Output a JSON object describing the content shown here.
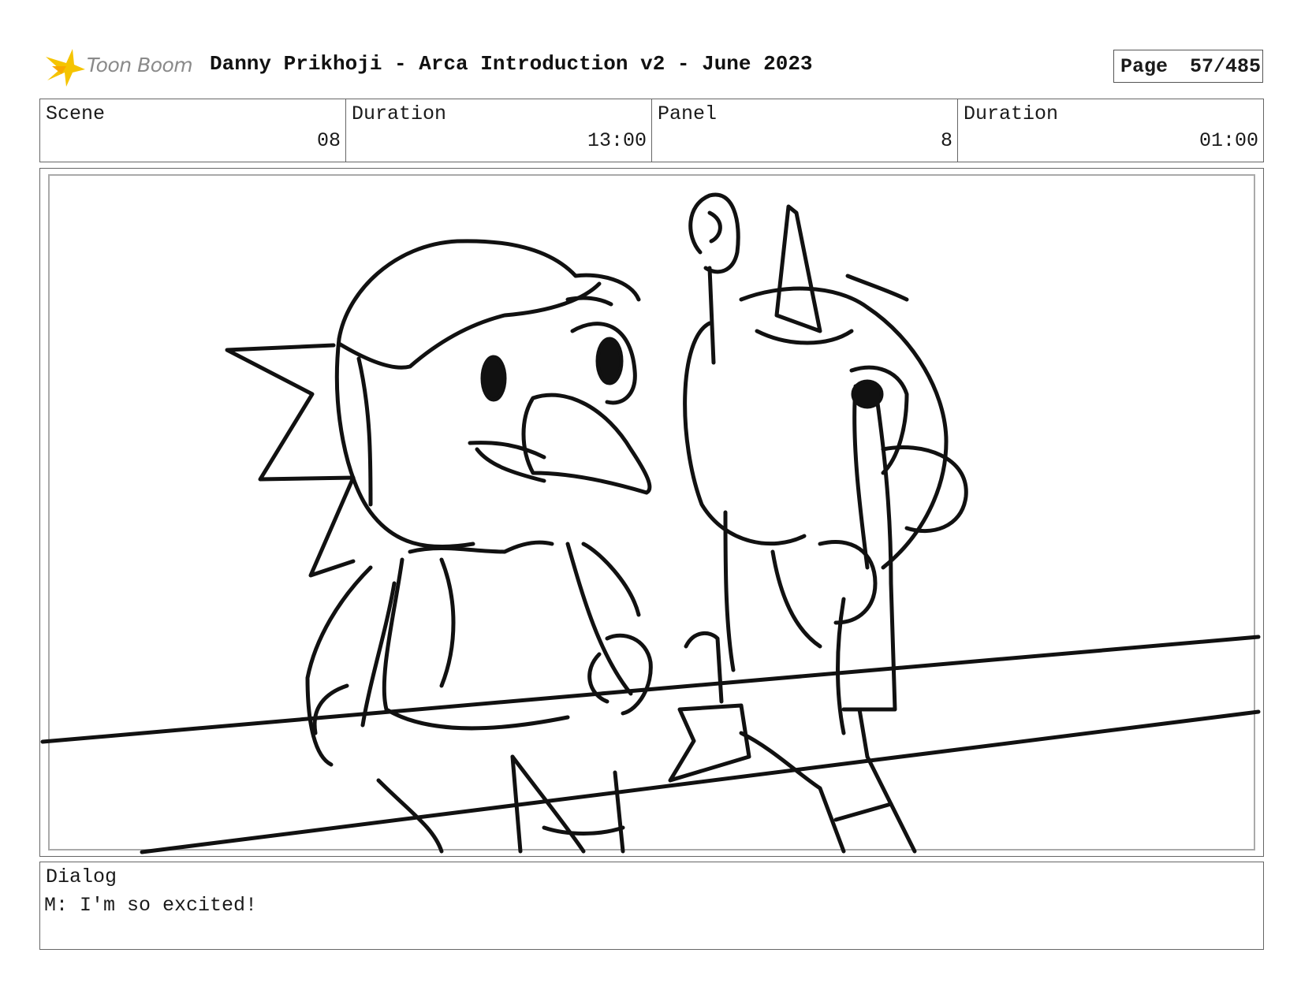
{
  "header": {
    "logo_text": "Toon Boom",
    "title": "Danny Prikhoji - Arca Introduction v2 - June 2023",
    "page_label": "Page",
    "page_number": "57/485"
  },
  "info": {
    "scene_label": "Scene",
    "scene_value": "08",
    "scene_duration_label": "Duration",
    "scene_duration_value": "13:00",
    "panel_label": "Panel",
    "panel_value": "8",
    "panel_duration_label": "Duration",
    "panel_duration_value": "01:00"
  },
  "dialog": {
    "label": "Dialog",
    "text": "M: I'm so excited!"
  },
  "colors": {
    "logo_star": "#f5c400",
    "ink": "#111111"
  }
}
